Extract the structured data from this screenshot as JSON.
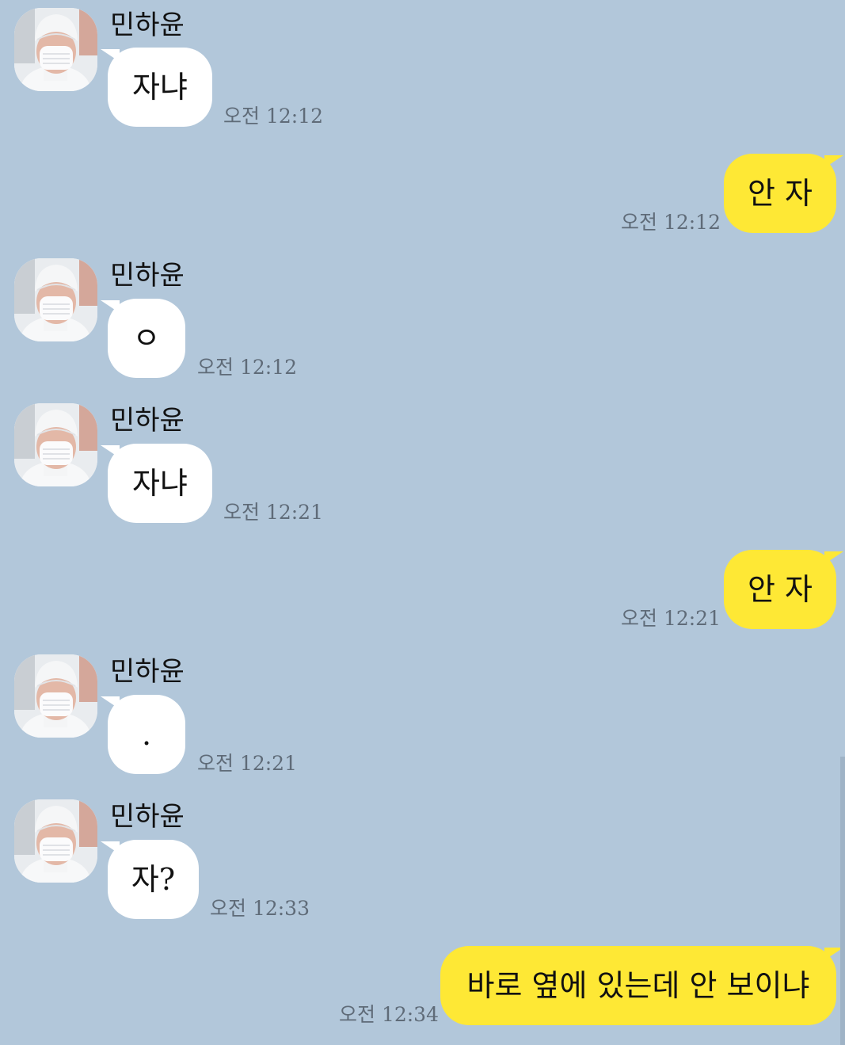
{
  "contact": {
    "name": "민하윤",
    "avatar_icon": "profile-photo-masked-person-icon"
  },
  "colors": {
    "background": "#b2c7da",
    "incoming_bubble": "#ffffff",
    "outgoing_bubble": "#fee835",
    "timestamp_text": "#5f6b78"
  },
  "messages": [
    {
      "direction": "incoming",
      "sender": "민하윤",
      "text": "자냐",
      "time": "오전 12:12"
    },
    {
      "direction": "outgoing",
      "text": "안 자",
      "time": "오전 12:12"
    },
    {
      "direction": "incoming",
      "sender": "민하윤",
      "text": "ㅇ",
      "time": "오전 12:12"
    },
    {
      "direction": "incoming",
      "sender": "민하윤",
      "text": "자냐",
      "time": "오전 12:21"
    },
    {
      "direction": "outgoing",
      "text": "안 자",
      "time": "오전 12:21"
    },
    {
      "direction": "incoming",
      "sender": "민하윤",
      "text": ".",
      "time": "오전 12:21"
    },
    {
      "direction": "incoming",
      "sender": "민하윤",
      "text": "자?",
      "time": "오전 12:33"
    },
    {
      "direction": "outgoing",
      "text": "바로 옆에 있는데 안 보이냐",
      "time": "오전 12:34"
    }
  ]
}
